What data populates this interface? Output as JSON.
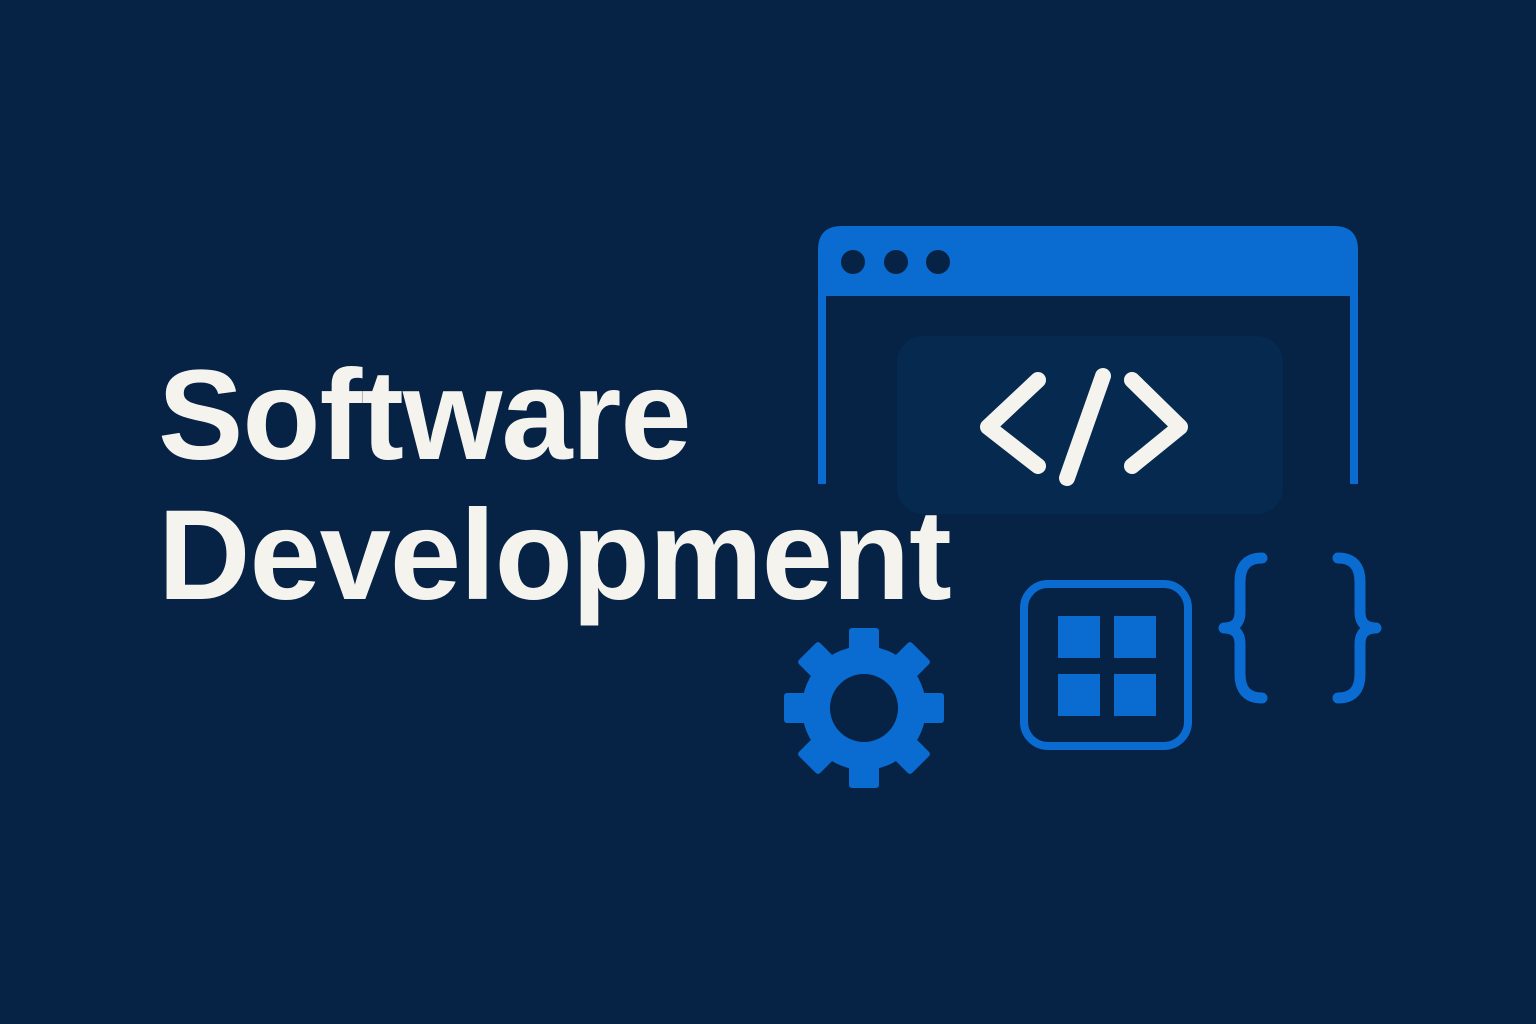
{
  "headline": {
    "line1": "Software",
    "line2": "Development"
  },
  "icons": {
    "window": "browser-window-icon",
    "code": "code-tag-icon",
    "gear": "gear-icon",
    "grid": "grid-module-icon",
    "braces": "curly-braces-icon"
  },
  "colors": {
    "background": "#062244",
    "accent_blue": "#0A6BD1",
    "panel": "#05294F",
    "text": "#F5F3EE"
  }
}
